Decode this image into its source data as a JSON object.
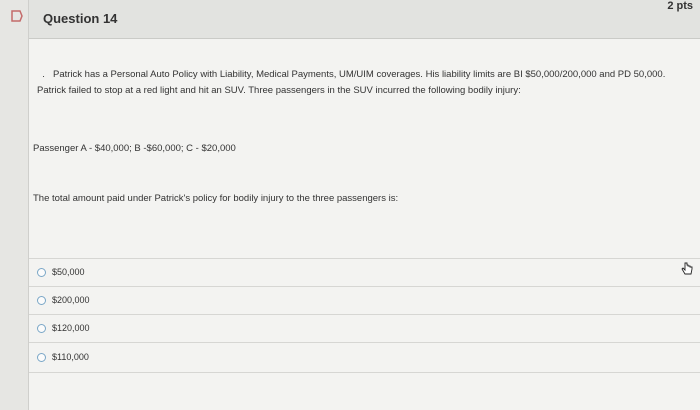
{
  "question": {
    "title": "Question 14",
    "points": "2 pts",
    "paragraph": "Patrick has a Personal Auto Policy with Liability, Medical Payments, UM/UIM    coverages. His liability limits are BI $50,000/200,000 and PD 50,000. Patrick failed to stop at a red light and hit an SUV. Three passengers in the SUV incurred the following bodily injury:",
    "passengers": "Passenger A - $40,000; B -$60,000; C - $20,000",
    "prompt": "The total amount paid under Patrick's policy for bodily injury to the three passengers is:",
    "options": [
      {
        "label": "$50,000"
      },
      {
        "label": "$200,000"
      },
      {
        "label": "$120,000"
      },
      {
        "label": "$110,000"
      }
    ]
  },
  "icons": {
    "flag": "flag-icon",
    "cursor": "hand-pointer-icon"
  },
  "colors": {
    "flag": "#c46b6b",
    "radio_border": "#7aa7c7"
  }
}
